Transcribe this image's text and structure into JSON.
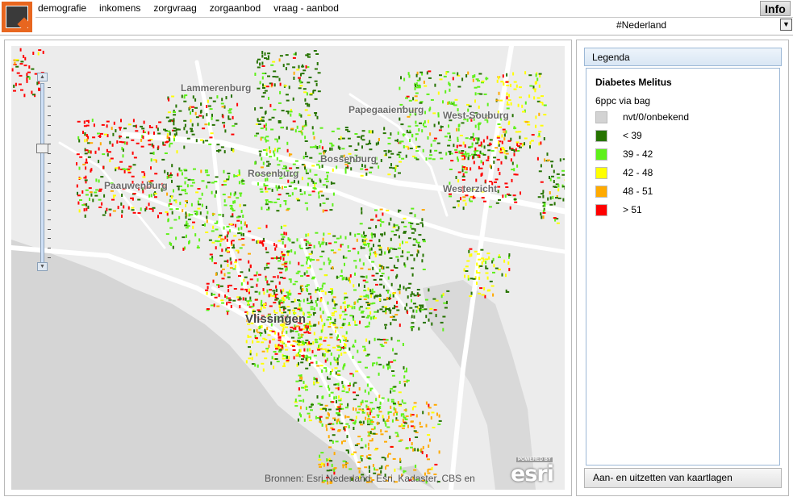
{
  "nav": {
    "items": [
      "demografie",
      "inkomens",
      "zorgvraag",
      "zorgaanbod",
      "vraag - aanbod"
    ],
    "info_label": "Info"
  },
  "region": {
    "selected": "#Nederland"
  },
  "map": {
    "labels": {
      "lammerenburg": "Lammerenburg",
      "papegaaienburg": "Papegaaienburg",
      "westsouburg": "West-Souburg",
      "bossenburg": "Bossenburg",
      "rosenburg": "Rosenburg",
      "paauwenburg": "Paauwenburg",
      "westerzicht": "Westerzicht",
      "vlissingen": "Vlissingen"
    },
    "attribution": "Bronnen: Esri Nederland, Esri, Kadaster, CBS en",
    "esri_powered": "POWERED BY",
    "esri_text": "esri",
    "colors": {
      "water": "#d5d5d5",
      "land": "#ececec",
      "road": "#ffffff"
    }
  },
  "legend": {
    "header": "Legenda",
    "title": "Diabetes Melitus",
    "subtitle": "6ppc via bag",
    "items": [
      {
        "label": "nvt/0/onbekend",
        "color": "#d3d3d3"
      },
      {
        "label": "< 39",
        "color": "#267300"
      },
      {
        "label": "39 - 42",
        "color": "#5ef019"
      },
      {
        "label": "42 - 48",
        "color": "#ffff00"
      },
      {
        "label": "48 - 51",
        "color": "#ffaa00"
      },
      {
        "label": "> 51",
        "color": "#ff0000"
      }
    ]
  },
  "layers_toggle": "Aan- en uitzetten van kaartlagen"
}
